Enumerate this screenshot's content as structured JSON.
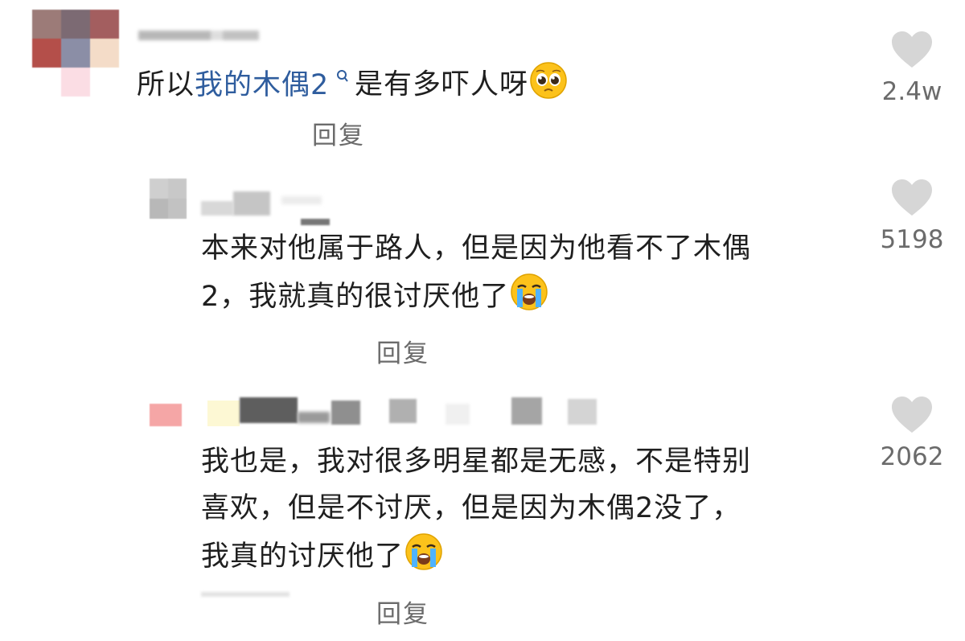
{
  "comments": [
    {
      "id": "c1",
      "text_prefix": "所以",
      "link_text": "我的木偶2",
      "text_suffix": "是有多吓人呀",
      "emoji": "pleading-face-emoji",
      "likes": "2.4w",
      "reply_label": "回复"
    },
    {
      "id": "c2",
      "line1": "本来对他属于路人，但是因为他看不了木偶",
      "line2": "2，我就真的很讨厌他了",
      "emoji": "loudly-crying-face-emoji",
      "likes": "5198",
      "reply_label": "回复"
    },
    {
      "id": "c3",
      "line1": "我也是，我对很多明星都是无感，不是特别",
      "line2": "喜欢，但是不讨厌，但是因为木偶2没了，",
      "line3": "我真的讨厌他了",
      "emoji": "loudly-crying-face-emoji",
      "likes": "2062",
      "reply_label": "回复"
    }
  ],
  "icons": {
    "like": "heart-icon",
    "search_hint": "search-icon"
  },
  "colors": {
    "link": "#2f5d9e",
    "meta": "#6b6b6b",
    "heart": "#d6d6d6"
  }
}
